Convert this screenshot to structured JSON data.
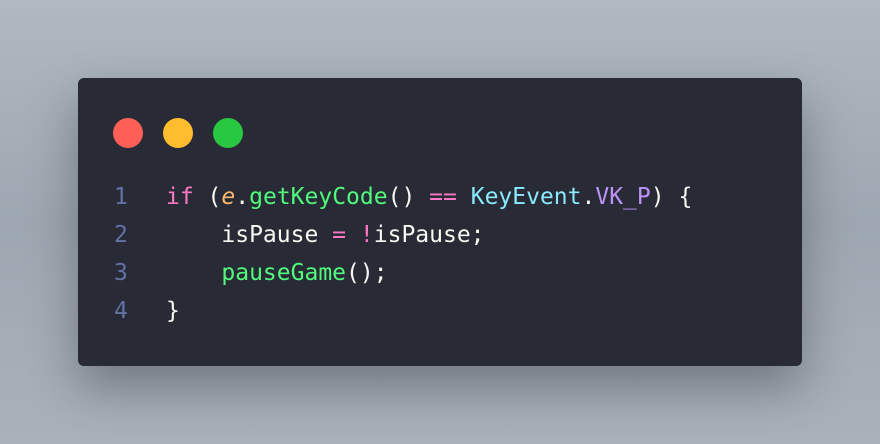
{
  "window": {
    "traffic_lights": [
      {
        "name": "close",
        "color": "#ff5f57"
      },
      {
        "name": "minimize",
        "color": "#febc2e"
      },
      {
        "name": "maximize",
        "color": "#28c840"
      }
    ]
  },
  "colors": {
    "background": "#282a36",
    "line_number": "#6272a4",
    "keyword": "#ff79c6",
    "function": "#50fa7b",
    "class": "#8be9fd",
    "constant": "#bd93f9",
    "parameter": "#ffb86c",
    "text": "#f8f8f2"
  },
  "code": {
    "lines": [
      {
        "number": "1",
        "tokens": [
          {
            "t": "if",
            "c": "kw"
          },
          {
            "t": " (",
            "c": "txt"
          },
          {
            "t": "e",
            "c": "param"
          },
          {
            "t": ".",
            "c": "txt"
          },
          {
            "t": "getKeyCode",
            "c": "fn"
          },
          {
            "t": "() ",
            "c": "txt"
          },
          {
            "t": "==",
            "c": "op"
          },
          {
            "t": " ",
            "c": "txt"
          },
          {
            "t": "KeyEvent",
            "c": "cls"
          },
          {
            "t": ".",
            "c": "txt"
          },
          {
            "t": "VK_P",
            "c": "const"
          },
          {
            "t": ") {",
            "c": "txt"
          }
        ]
      },
      {
        "number": "2",
        "tokens": [
          {
            "t": "    isPause ",
            "c": "txt"
          },
          {
            "t": "=",
            "c": "op"
          },
          {
            "t": " ",
            "c": "txt"
          },
          {
            "t": "!",
            "c": "op"
          },
          {
            "t": "isPause;",
            "c": "txt"
          }
        ]
      },
      {
        "number": "3",
        "tokens": [
          {
            "t": "    ",
            "c": "txt"
          },
          {
            "t": "pauseGame",
            "c": "fn"
          },
          {
            "t": "();",
            "c": "txt"
          }
        ]
      },
      {
        "number": "4",
        "tokens": [
          {
            "t": "}",
            "c": "txt"
          }
        ]
      }
    ]
  }
}
